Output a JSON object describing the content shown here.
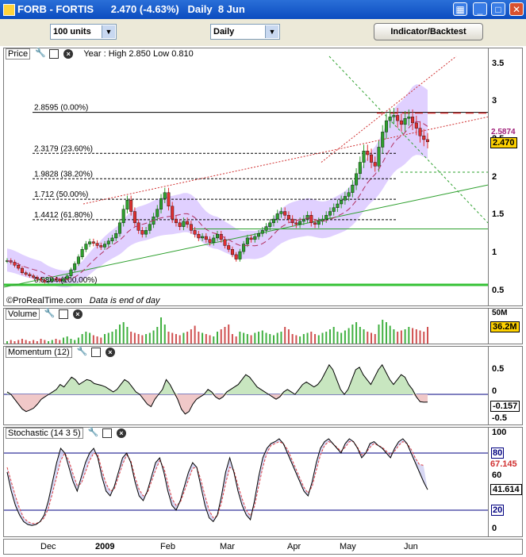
{
  "window": {
    "title": "FORB - FORTIS      2.470 (-4.63%)   Daily  8 Jun"
  },
  "toolbar": {
    "units": "100 units",
    "period": "Daily",
    "indicator_button": "Indicator/Backtest"
  },
  "price_panel": {
    "name": "Price",
    "info": "Year : High 2.850 Low 0.810",
    "credit": "©ProRealTime.com",
    "credit_note": "Data is end of day",
    "last_price": "2.470",
    "ma_value": "2.5874",
    "axis_ticks": [
      "3.5",
      "3",
      "2.5",
      "2",
      "1.5",
      "1",
      "0.5"
    ],
    "fib_levels": [
      {
        "label": "2.8595 (0.00%)",
        "value": 2.8595
      },
      {
        "label": "2.3179 (23.60%)",
        "value": 2.3179
      },
      {
        "label": "1.9828 (38.20%)",
        "value": 1.9828
      },
      {
        "label": "1.712 (50.00%)",
        "value": 1.712
      },
      {
        "label": "1.4412 (61.80%)",
        "value": 1.4412
      },
      {
        "label": "0.5804 (100.00%)",
        "value": 0.5804
      }
    ]
  },
  "volume_panel": {
    "name": "Volume",
    "axis_top": "50M",
    "last_value": "36.2M"
  },
  "momentum_panel": {
    "name": "Momentum (12)",
    "axis_ticks": [
      "0.5",
      "0",
      "-0.5"
    ],
    "last_value": "-0.157"
  },
  "stochastic_panel": {
    "name": "Stochastic (14 3 5)",
    "axis_ticks": [
      "100",
      "80",
      "60",
      "20",
      "0"
    ],
    "signal_value": "67.145",
    "last_value": "41.614"
  },
  "x_axis": {
    "labels": [
      "Dec",
      "2009",
      "Feb",
      "Mar",
      "Apr",
      "May",
      "Jun"
    ]
  },
  "colors": {
    "up": "#2ea02e",
    "down": "#e03030",
    "band": "#e0d0ff",
    "fib": "#000000",
    "support": "#34c234"
  },
  "chart_data": {
    "type": "candlestick",
    "title": "FORB - FORTIS Daily",
    "x": [
      "Dec",
      "2009",
      "Feb",
      "Mar",
      "Apr",
      "May",
      "Jun"
    ],
    "ylim": [
      0.35,
      3.6
    ],
    "year_high": 2.85,
    "year_low": 0.81,
    "last": 2.47,
    "change_pct": -4.63,
    "close_series": [
      0.9,
      0.88,
      0.84,
      0.8,
      0.74,
      0.72,
      0.7,
      0.68,
      0.66,
      0.64,
      0.62,
      0.63,
      0.66,
      0.65,
      0.63,
      0.66,
      0.7,
      0.78,
      0.86,
      0.95,
      1.05,
      1.12,
      1.15,
      1.13,
      1.1,
      1.08,
      1.12,
      1.16,
      1.2,
      1.26,
      1.4,
      1.58,
      1.7,
      1.55,
      1.4,
      1.3,
      1.25,
      1.3,
      1.38,
      1.48,
      1.58,
      1.72,
      1.8,
      1.62,
      1.45,
      1.4,
      1.35,
      1.42,
      1.38,
      1.3,
      1.25,
      1.2,
      1.22,
      1.18,
      1.14,
      1.2,
      1.25,
      1.18,
      1.1,
      1.05,
      0.98,
      0.92,
      1.02,
      1.12,
      1.2,
      1.18,
      1.22,
      1.26,
      1.3,
      1.35,
      1.4,
      1.45,
      1.52,
      1.55,
      1.5,
      1.45,
      1.4,
      1.38,
      1.42,
      1.45,
      1.5,
      1.4,
      1.38,
      1.42,
      1.45,
      1.5,
      1.55,
      1.6,
      1.65,
      1.7,
      1.75,
      1.8,
      1.9,
      2.05,
      2.2,
      2.35,
      2.3,
      2.2,
      2.15,
      2.4,
      2.6,
      2.75,
      2.8,
      2.82,
      2.75,
      2.7,
      2.78,
      2.8,
      2.72,
      2.65,
      2.55,
      2.5,
      2.47
    ],
    "volume_series": [
      2,
      3,
      2,
      3,
      4,
      3,
      2,
      3,
      2,
      4,
      3,
      2,
      3,
      4,
      3,
      5,
      6,
      4,
      3,
      5,
      8,
      10,
      9,
      7,
      6,
      5,
      8,
      9,
      10,
      12,
      16,
      18,
      14,
      10,
      9,
      8,
      7,
      8,
      9,
      11,
      14,
      22,
      16,
      10,
      9,
      8,
      7,
      9,
      10,
      12,
      15,
      10,
      9,
      8,
      7,
      6,
      10,
      12,
      14,
      16,
      8,
      6,
      10,
      9,
      8,
      7,
      9,
      10,
      11,
      9,
      8,
      7,
      9,
      10,
      14,
      12,
      8,
      7,
      6,
      8,
      9,
      10,
      8,
      7,
      9,
      10,
      12,
      14,
      10,
      9,
      11,
      13,
      16,
      18,
      14,
      12,
      10,
      9,
      8,
      16,
      20,
      18,
      15,
      12,
      10,
      11,
      12,
      14,
      13,
      12,
      11,
      10,
      14
    ],
    "momentum_series": [
      0.05,
      0.0,
      -0.1,
      -0.2,
      -0.3,
      -0.35,
      -0.32,
      -0.28,
      -0.2,
      -0.1,
      -0.05,
      0.0,
      0.05,
      0.1,
      0.2,
      0.15,
      0.25,
      0.35,
      0.3,
      0.2,
      0.25,
      0.3,
      0.28,
      0.22,
      0.2,
      0.18,
      0.15,
      0.1,
      0.05,
      0.1,
      0.2,
      0.3,
      0.25,
      0.15,
      0.05,
      0.0,
      -0.1,
      -0.2,
      -0.25,
      -0.1,
      0.0,
      0.1,
      0.3,
      0.2,
      0.05,
      -0.1,
      -0.3,
      -0.4,
      -0.35,
      -0.2,
      -0.1,
      -0.05,
      0.0,
      0.1,
      0.05,
      -0.05,
      -0.1,
      -0.05,
      0.05,
      0.1,
      0.15,
      0.2,
      0.3,
      0.4,
      0.35,
      0.25,
      0.15,
      0.1,
      0.05,
      0.0,
      -0.05,
      -0.1,
      -0.05,
      0.05,
      0.1,
      0.05,
      0.0,
      0.1,
      0.2,
      0.25,
      0.2,
      0.15,
      0.2,
      0.3,
      0.45,
      0.6,
      0.5,
      0.3,
      0.1,
      0.0,
      0.1,
      0.3,
      0.5,
      0.55,
      0.4,
      0.3,
      0.2,
      0.35,
      0.5,
      0.6,
      0.45,
      0.3,
      0.2,
      0.3,
      0.4,
      0.35,
      0.2,
      0.1,
      -0.05,
      -0.15,
      -0.16,
      -0.157
    ],
    "stochastic_k_series": [
      60,
      40,
      25,
      15,
      8,
      5,
      4,
      5,
      8,
      15,
      30,
      50,
      70,
      85,
      80,
      65,
      50,
      40,
      55,
      70,
      80,
      85,
      75,
      55,
      40,
      35,
      45,
      60,
      75,
      80,
      70,
      50,
      35,
      30,
      40,
      55,
      70,
      75,
      60,
      40,
      25,
      20,
      30,
      45,
      60,
      70,
      65,
      45,
      25,
      12,
      8,
      15,
      35,
      60,
      75,
      60,
      40,
      25,
      15,
      10,
      30,
      55,
      75,
      85,
      90,
      92,
      95,
      90,
      80,
      70,
      60,
      50,
      40,
      35,
      50,
      70,
      85,
      92,
      95,
      90,
      85,
      80,
      90,
      95,
      92,
      85,
      75,
      80,
      90,
      92,
      88,
      85,
      80,
      75,
      85,
      92,
      95,
      90,
      80,
      70,
      60,
      50,
      41.614
    ],
    "stochastic_d_series": [
      65,
      50,
      35,
      22,
      12,
      8,
      6,
      6,
      8,
      12,
      22,
      38,
      55,
      72,
      80,
      72,
      58,
      46,
      48,
      60,
      72,
      80,
      78,
      62,
      48,
      40,
      42,
      55,
      68,
      78,
      72,
      55,
      42,
      35,
      38,
      50,
      62,
      72,
      65,
      48,
      32,
      25,
      28,
      40,
      52,
      64,
      65,
      52,
      35,
      20,
      12,
      14,
      28,
      48,
      65,
      62,
      46,
      32,
      20,
      14,
      24,
      45,
      65,
      80,
      88,
      90,
      92,
      90,
      84,
      74,
      64,
      54,
      44,
      38,
      45,
      62,
      78,
      88,
      92,
      90,
      86,
      82,
      86,
      92,
      92,
      86,
      78,
      80,
      86,
      90,
      88,
      86,
      82,
      78,
      82,
      88,
      92,
      90,
      84,
      75,
      68,
      67.145
    ]
  }
}
